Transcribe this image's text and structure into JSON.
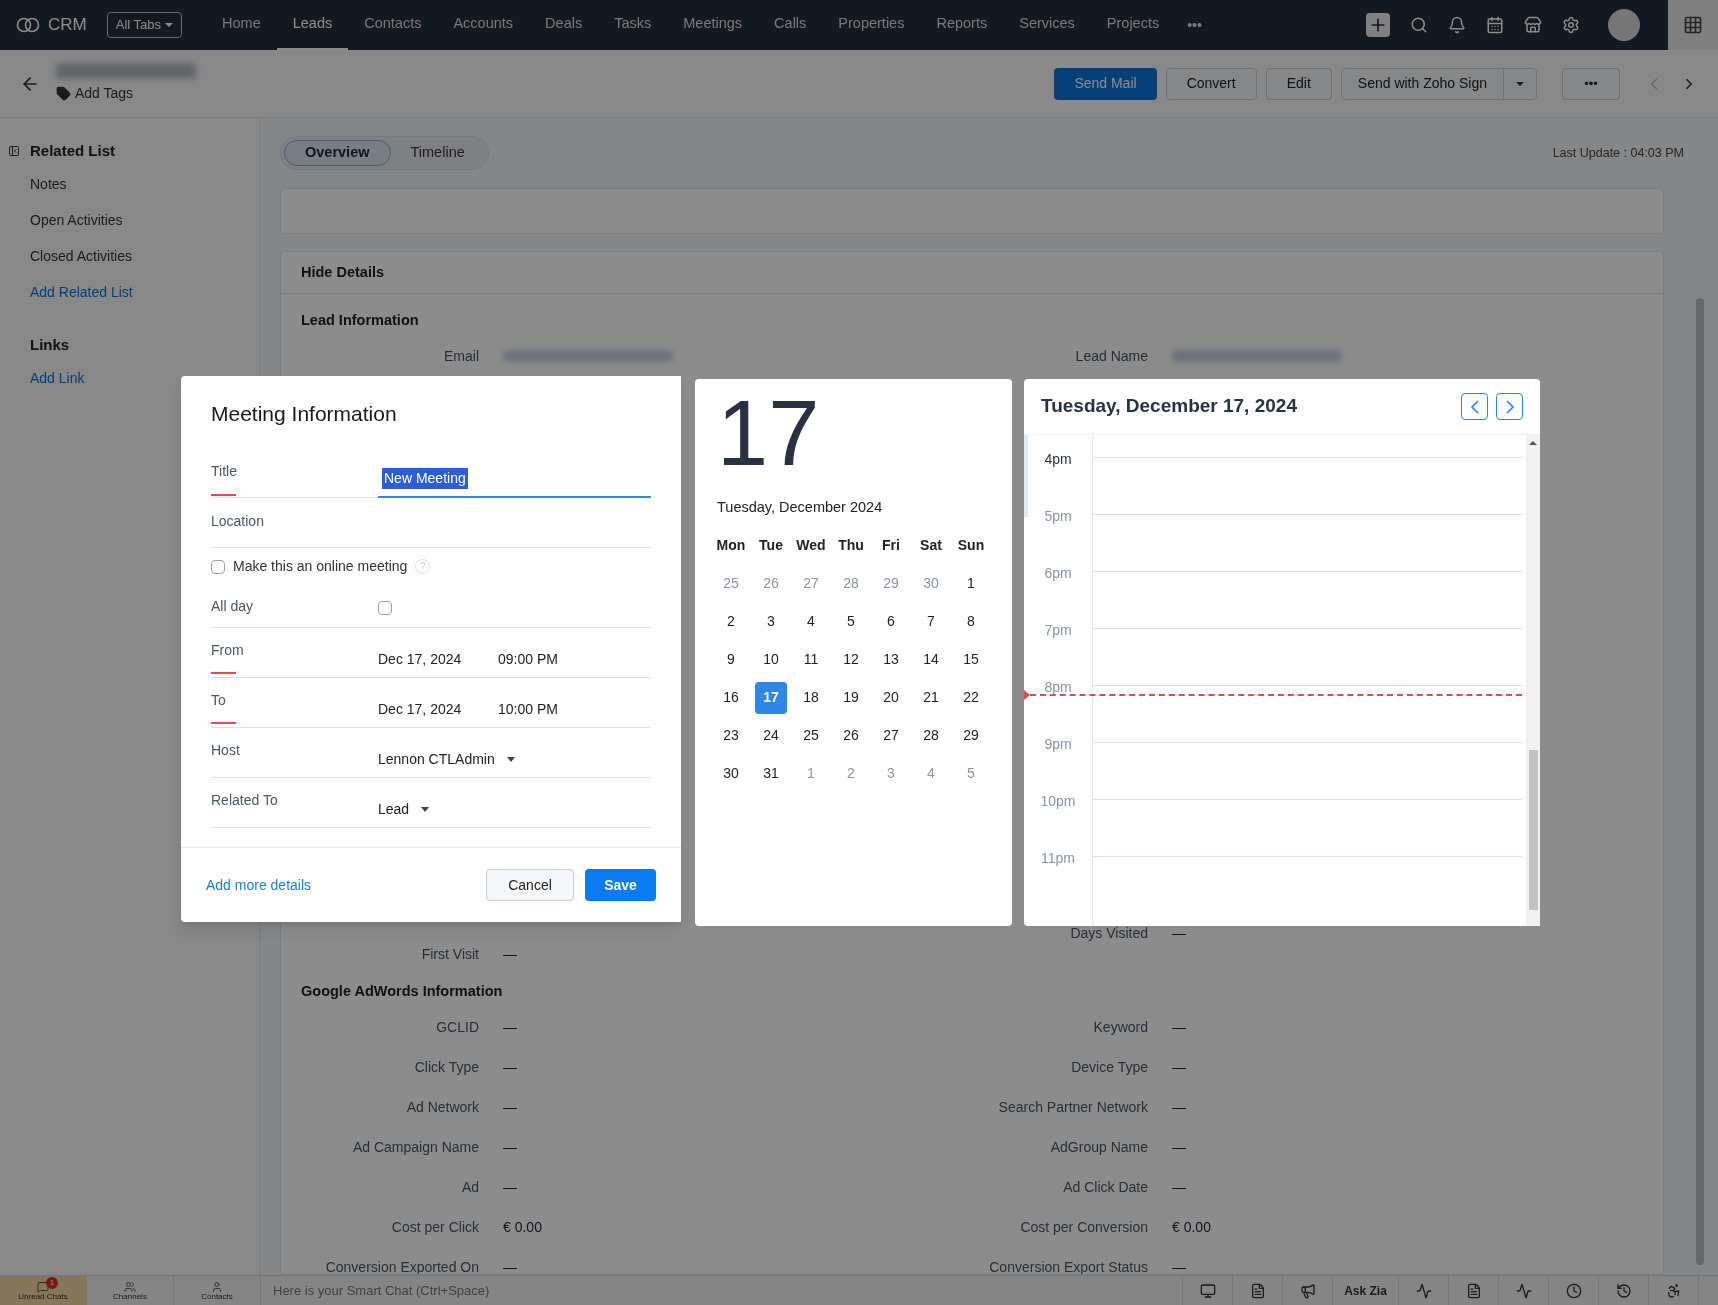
{
  "nav": {
    "brand": "CRM",
    "all_tabs": "All Tabs",
    "more": "•••",
    "items": [
      {
        "label": "Home",
        "selected": false
      },
      {
        "label": "Leads",
        "selected": true
      },
      {
        "label": "Contacts",
        "selected": false
      },
      {
        "label": "Accounts",
        "selected": false
      },
      {
        "label": "Deals",
        "selected": false
      },
      {
        "label": "Tasks",
        "selected": false
      },
      {
        "label": "Meetings",
        "selected": false
      },
      {
        "label": "Calls",
        "selected": false
      },
      {
        "label": "Properties",
        "selected": false
      },
      {
        "label": "Reports",
        "selected": false
      },
      {
        "label": "Services",
        "selected": false
      },
      {
        "label": "Projects",
        "selected": false
      }
    ]
  },
  "header": {
    "add_tags": "Add Tags",
    "primary": "Send Mail",
    "buttons": [
      "Convert",
      "Edit"
    ],
    "split_button": "Send with Zoho Sign",
    "more": "•••"
  },
  "sidebar": {
    "sections": [
      {
        "title": "Related List",
        "items": [
          {
            "label": "Notes",
            "kind": "item"
          },
          {
            "label": "Open Activities",
            "kind": "item"
          },
          {
            "label": "Closed Activities",
            "kind": "item"
          },
          {
            "label": "Add Related List",
            "kind": "link"
          }
        ]
      },
      {
        "title": "Links",
        "items": [
          {
            "label": "Add Link",
            "kind": "link"
          }
        ]
      }
    ]
  },
  "tabs": [
    {
      "label": "Overview",
      "selected": true
    },
    {
      "label": "Timeline",
      "selected": false
    }
  ],
  "last_update": "Last Update : 04:03 PM",
  "details": {
    "toggle": "Hide Details",
    "sections": [
      {
        "title": "Lead Information",
        "rows": [
          {
            "left": {
              "label": "Email"
            },
            "right": {
              "label": "Lead Name"
            }
          }
        ]
      },
      {
        "rows": [
          {
            "right": {
              "label": "Days Visited",
              "value": "—"
            }
          },
          {
            "left": {
              "label": "First Visit",
              "value": "—"
            }
          }
        ]
      },
      {
        "title": "Google AdWords Information",
        "rows": [
          {
            "left": {
              "label": "GCLID",
              "value": "—"
            },
            "right": {
              "label": "Keyword",
              "value": "—"
            }
          },
          {
            "left": {
              "label": "Click Type",
              "value": "—"
            },
            "right": {
              "label": "Device Type",
              "value": "—"
            }
          },
          {
            "left": {
              "label": "Ad Network",
              "value": "—"
            },
            "right": {
              "label": "Search Partner Network",
              "value": "—"
            }
          },
          {
            "left": {
              "label": "Ad Campaign Name",
              "value": "—"
            },
            "right": {
              "label": "AdGroup Name",
              "value": "—"
            }
          },
          {
            "left": {
              "label": "Ad",
              "value": "—"
            },
            "right": {
              "label": "Ad Click Date",
              "value": "—"
            }
          },
          {
            "left": {
              "label": "Cost per Click",
              "value": "€ 0.00"
            },
            "right": {
              "label": "Cost per Conversion",
              "value": "€ 0.00"
            }
          },
          {
            "left": {
              "label": "Conversion Exported On",
              "value": "—"
            },
            "right": {
              "label": "Conversion Export Status",
              "value": "—"
            }
          }
        ]
      }
    ]
  },
  "meeting_dialog": {
    "title": "Meeting Information",
    "fields": [
      {
        "kind": "text",
        "label": "Title",
        "value": "New Meeting",
        "required": true,
        "highlighted": true
      },
      {
        "kind": "text",
        "label": "Location",
        "required": false
      },
      {
        "kind": "check",
        "label": "Make this an online meeting",
        "checked": false,
        "help": "?"
      },
      {
        "kind": "checkbox",
        "label": "All day",
        "checked": false
      },
      {
        "kind": "datetime",
        "label": "From",
        "date": "Dec 17, 2024",
        "time": "09:00 PM",
        "required": true
      },
      {
        "kind": "datetime",
        "label": "To",
        "date": "Dec 17, 2024",
        "time": "10:00 PM",
        "required": true
      },
      {
        "kind": "select",
        "label": "Host",
        "value": "Lennon CTLAdmin",
        "required": false
      },
      {
        "kind": "select",
        "label": "Related To",
        "value": "Lead",
        "required": false
      }
    ],
    "link": "Add more details",
    "cancel": "Cancel",
    "save": "Save"
  },
  "mini_calendar": {
    "big_day": "17",
    "subtitle": "Tuesday, December 2024",
    "weekdays": [
      "Mon",
      "Tue",
      "Wed",
      "Thu",
      "Fri",
      "Sat",
      "Sun"
    ],
    "days": [
      {
        "label": "25",
        "muted": true,
        "selected": false
      },
      {
        "label": "26",
        "muted": true,
        "selected": false
      },
      {
        "label": "27",
        "muted": true,
        "selected": false
      },
      {
        "label": "28",
        "muted": true,
        "selected": false
      },
      {
        "label": "29",
        "muted": true,
        "selected": false
      },
      {
        "label": "30",
        "muted": true,
        "selected": false
      },
      {
        "label": "1",
        "muted": false,
        "selected": false
      },
      {
        "label": "2",
        "muted": false,
        "selected": false
      },
      {
        "label": "3",
        "muted": false,
        "selected": false
      },
      {
        "label": "4",
        "muted": false,
        "selected": false
      },
      {
        "label": "5",
        "muted": false,
        "selected": false
      },
      {
        "label": "6",
        "muted": false,
        "selected": false
      },
      {
        "label": "7",
        "muted": false,
        "selected": false
      },
      {
        "label": "8",
        "muted": false,
        "selected": false
      },
      {
        "label": "9",
        "muted": false,
        "selected": false
      },
      {
        "label": "10",
        "muted": false,
        "selected": false
      },
      {
        "label": "11",
        "muted": false,
        "selected": false
      },
      {
        "label": "12",
        "muted": false,
        "selected": false
      },
      {
        "label": "13",
        "muted": false,
        "selected": false
      },
      {
        "label": "14",
        "muted": false,
        "selected": false
      },
      {
        "label": "15",
        "muted": false,
        "selected": false
      },
      {
        "label": "16",
        "muted": false,
        "selected": false
      },
      {
        "label": "17",
        "muted": false,
        "selected": true
      },
      {
        "label": "18",
        "muted": false,
        "selected": false
      },
      {
        "label": "19",
        "muted": false,
        "selected": false
      },
      {
        "label": "20",
        "muted": false,
        "selected": false
      },
      {
        "label": "21",
        "muted": false,
        "selected": false
      },
      {
        "label": "22",
        "muted": false,
        "selected": false
      },
      {
        "label": "23",
        "muted": false,
        "selected": false
      },
      {
        "label": "24",
        "muted": false,
        "selected": false
      },
      {
        "label": "25",
        "muted": false,
        "selected": false
      },
      {
        "label": "26",
        "muted": false,
        "selected": false
      },
      {
        "label": "27",
        "muted": false,
        "selected": false
      },
      {
        "label": "28",
        "muted": false,
        "selected": false
      },
      {
        "label": "29",
        "muted": false,
        "selected": false
      },
      {
        "label": "30",
        "muted": false,
        "selected": false
      },
      {
        "label": "31",
        "muted": false,
        "selected": false
      },
      {
        "label": "1",
        "muted": true,
        "selected": false
      },
      {
        "label": "2",
        "muted": true,
        "selected": false
      },
      {
        "label": "3",
        "muted": true,
        "selected": false
      },
      {
        "label": "4",
        "muted": true,
        "selected": false
      },
      {
        "label": "5",
        "muted": true,
        "selected": false
      }
    ]
  },
  "day_view": {
    "title": "Tuesday, December 17, 2024",
    "hours": [
      {
        "label": "4pm",
        "now": false
      },
      {
        "label": "5pm",
        "now": false
      },
      {
        "label": "6pm",
        "now": false
      },
      {
        "label": "7pm",
        "now": false
      },
      {
        "label": "8pm",
        "now": true
      },
      {
        "label": "9pm",
        "now": false
      },
      {
        "label": "10pm",
        "now": false
      },
      {
        "label": "11pm",
        "now": false
      }
    ]
  },
  "bottom_bar": {
    "tabs": [
      {
        "label": "Unread Chats",
        "badge": "1",
        "selected": true
      },
      {
        "label": "Channels",
        "selected": false
      },
      {
        "label": "Contacts",
        "selected": false
      }
    ],
    "chat_placeholder": "Here is your Smart Chat (Ctrl+Space)",
    "ask_zia": "Ask Zia"
  }
}
